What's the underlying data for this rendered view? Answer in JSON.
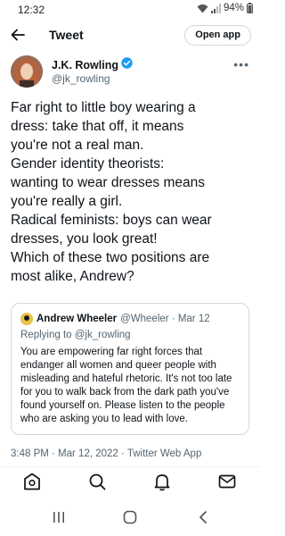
{
  "status": {
    "time": "12:32",
    "battery": "94%"
  },
  "header": {
    "title": "Tweet",
    "open_app_label": "Open app"
  },
  "tweet": {
    "author_name": "J.K. Rowling",
    "author_handle": "@jk_rowling",
    "text_lines": [
      "Far right to little boy wearing a",
      "dress: take that off, it means",
      "you're not a real man.",
      "Gender identity theorists:",
      "wanting to wear dresses means",
      "you're really a girl.",
      "Radical feminists: boys can wear",
      "dresses, you look great!",
      "Which of these two positions are",
      "most alike, Andrew?"
    ],
    "timestamp": "3:48 PM · Mar 12, 2022 · Twitter Web App"
  },
  "quote": {
    "author_name": "Andrew Wheeler",
    "author_meta": "@Wheeler · Mar 12",
    "replying_prefix": "Replying to ",
    "replying_handle": "@jk_rowling",
    "body_lines": [
      "You are empowering far right forces that",
      "endanger all women and queer people with",
      "misleading and hateful rhetoric. It's not too late",
      "for you to walk back from the dark path you've",
      "found yourself on. Please listen to the people",
      "who are asking you to lead with love."
    ]
  },
  "icons": {
    "status": [
      "wifi-icon",
      "signal-icon",
      "battery-icon"
    ],
    "header": [
      "back-arrow-icon"
    ],
    "tab_bar": [
      "home-icon",
      "search-icon",
      "notifications-icon",
      "messages-icon"
    ],
    "nav_bar": [
      "recent-apps-icon",
      "home-button-icon",
      "back-nav-icon"
    ]
  },
  "colors": {
    "verified_badge": "#1d9bf0",
    "secondary_text": "#536471",
    "border": "#cfd9de"
  }
}
